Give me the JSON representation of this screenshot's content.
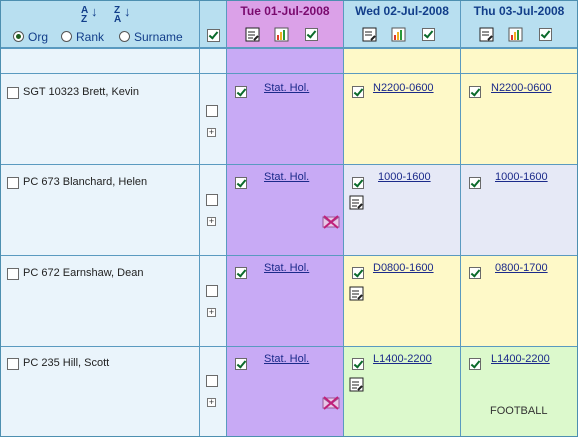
{
  "sort": {
    "options": [
      {
        "label": "Org",
        "selected": true
      },
      {
        "label": "Rank",
        "selected": false
      },
      {
        "label": "Surname",
        "selected": false
      }
    ],
    "asc_icon": "sort-az-icon",
    "desc_icon": "sort-za-icon"
  },
  "days": [
    {
      "title": "Tue 01-Jul-2008",
      "today": true
    },
    {
      "title": "Wed 02-Jul-2008",
      "today": false
    },
    {
      "title": "Thu 03-Jul-2008",
      "today": false
    }
  ],
  "colors": {
    "header": "#b8dff0",
    "header_today": "#dba1e8",
    "col_today": "#c8aaf5",
    "shift_yellow": "#fef9c8",
    "shift_blue": "#e6e9f6",
    "shift_green": "#dcf9cc",
    "name_col": "#eaf4fb"
  },
  "rows": [
    {
      "name": "SGT 10323 Brett, Kevin",
      "cells": [
        {
          "shift": "Stat. Hol.",
          "doc": false,
          "noreply": false,
          "note": ""
        },
        {
          "shift": "N2200-0600",
          "doc": false,
          "noreply": false,
          "note": ""
        },
        {
          "shift": "N2200-0600",
          "doc": false,
          "noreply": false,
          "note": ""
        }
      ]
    },
    {
      "name": "PC 673 Blanchard, Helen",
      "cells": [
        {
          "shift": "Stat. Hol.",
          "doc": false,
          "noreply": true,
          "note": ""
        },
        {
          "shift": "1000-1600",
          "doc": true,
          "noreply": false,
          "note": ""
        },
        {
          "shift": "1000-1600",
          "doc": false,
          "noreply": false,
          "note": ""
        }
      ]
    },
    {
      "name": "PC 672 Earnshaw, Dean",
      "cells": [
        {
          "shift": "Stat. Hol.",
          "doc": false,
          "noreply": false,
          "note": ""
        },
        {
          "shift": "D0800-1600",
          "doc": true,
          "noreply": false,
          "note": ""
        },
        {
          "shift": "0800-1700",
          "doc": false,
          "noreply": false,
          "note": ""
        }
      ]
    },
    {
      "name": "PC 235 Hill, Scott",
      "cells": [
        {
          "shift": "Stat. Hol.",
          "doc": false,
          "noreply": true,
          "note": ""
        },
        {
          "shift": "L1400-2200",
          "doc": true,
          "noreply": false,
          "note": ""
        },
        {
          "shift": "L1400-2200",
          "doc": false,
          "noreply": false,
          "note": "FOOTBALL"
        }
      ]
    }
  ]
}
